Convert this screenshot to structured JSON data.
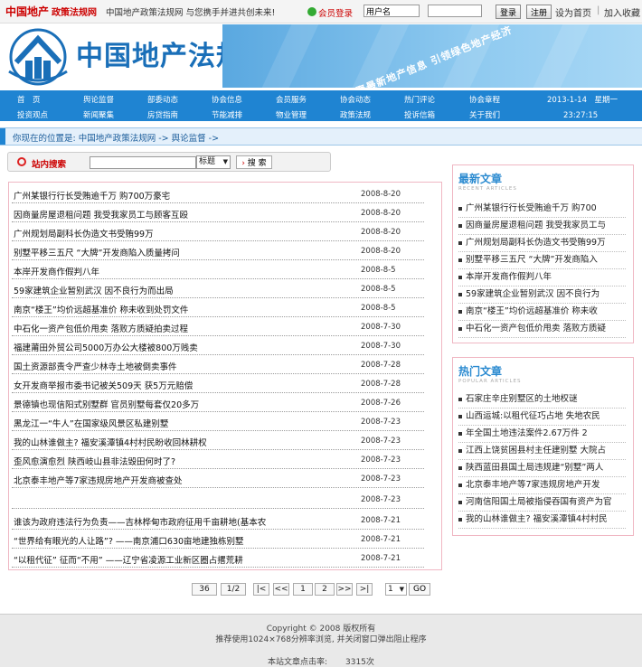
{
  "topbar": {
    "brand": "中国地产",
    "brand_sub": "政策法规网",
    "slogan": "中国地产政策法规网 与您携手并进共创未来!",
    "login_label": "会员登录",
    "username_value": "用户名",
    "login_button": "登录",
    "register_button": "注册",
    "set_home": "设为首页",
    "add_fav": "加入收藏"
  },
  "banner": {
    "logo_text": "中国地产法规网",
    "ad_text": "汇聚最新地产信息  引领绿色地产经济"
  },
  "nav": {
    "row1": [
      "首　页",
      "舆论监督",
      "部委动态",
      "协会信息",
      "会员服务",
      "协会动态",
      "热门评论",
      "协会章程"
    ],
    "row2": [
      "投资观点",
      "新闻聚集",
      "房贷指南",
      "节能减排",
      "物业管理",
      "政策法规",
      "投诉信箱",
      "关于我们"
    ],
    "date": "2013-1-14　星期一",
    "time": "23:27:15"
  },
  "breadcrumb": "你现在的位置是:  中国地产政策法规网 ->  舆论监督 ->",
  "search": {
    "label": "站内搜索",
    "select_value": "标题",
    "button": "搜 索"
  },
  "articles": [
    {
      "title": "广州某银行行长受贿逾千万 购700万豪宅",
      "date": "2008-8-20"
    },
    {
      "title": "因商量房屋退租问题 我受我家员工与顾客互殴",
      "date": "2008-8-20"
    },
    {
      "title": "广州规划局副科长伪造文书受贿99万",
      "date": "2008-8-20"
    },
    {
      "title": "别墅平移三五尺 “大牌”开发商陷入质量拷问",
      "date": "2008-8-20"
    },
    {
      "title": "本岸开发商作假判八年",
      "date": "2008-8-5"
    },
    {
      "title": "59家建筑企业暂别武汉 因不良行为而出局",
      "date": "2008-8-5"
    },
    {
      "title": "南京“楼王”均价远超基准价 称未收到处罚文件",
      "date": "2008-8-5"
    },
    {
      "title": "中石化一资产包低价甩卖 落败方质疑拍卖过程",
      "date": "2008-7-30"
    },
    {
      "title": "福建莆田外贸公司5000万办公大楼被800万贱卖",
      "date": "2008-7-30"
    },
    {
      "title": "国土资源部责令严查少林寺土地被倒卖事件",
      "date": "2008-7-28"
    },
    {
      "title": "女开发商举报市委书记被关509天 获5万元赔偿",
      "date": "2008-7-28"
    },
    {
      "title": "景德镇也现信阳式别墅群 官员别墅每套仅20多万",
      "date": "2008-7-26"
    },
    {
      "title": "黑龙江一“牛人”在国家级风景区私建别墅",
      "date": "2008-7-23"
    },
    {
      "title": "我的山林谁做主? 福安溪潭镇4村村民盼收回林耕权",
      "date": "2008-7-23"
    },
    {
      "title": "歪风愈演愈烈 陕西岐山县非法毁田何时了?",
      "date": "2008-7-23"
    },
    {
      "title": "北京泰丰地产等7家违规房地产开发商被查处",
      "date": "2008-7-23"
    },
    {
      "title": "",
      "date": "2008-7-23"
    },
    {
      "title": "谁该为政府违法行为负责——吉林桦甸市政府征用千亩耕地(基本农",
      "date": "2008-7-21"
    },
    {
      "title": "“世界给有眼光的人让路”? ——南京浦口630亩地建独栋别墅",
      "date": "2008-7-21"
    },
    {
      "title": "“以租代征” 征而“不用” ——辽宁省凌源工业新区圈占撂荒耕",
      "date": "2008-7-21"
    }
  ],
  "pager": {
    "total": "36",
    "page_of": "1/2",
    "first": "|<",
    "prev": "<<",
    "p1": "1",
    "p2": "2",
    "next": ">>",
    "last": ">|",
    "select_value": "1",
    "go": "GO"
  },
  "latest": {
    "title": "最新文章",
    "sub": "RECENT ARTICLES",
    "items": [
      "广州某银行行长受贿逾千万 购700",
      "因商量房屋退租问题 我受我家员工与",
      "广州规划局副科长伪造文书受贿99万",
      "别墅平移三五尺 “大牌”开发商陷入",
      "本岸开发商作假判八年",
      "59家建筑企业暂别武汉 因不良行为",
      "南京“楼王”均价远超基准价 称未收",
      "中石化一资产包低价甩卖 落败方质疑"
    ]
  },
  "popular": {
    "title": "热门文章",
    "sub": "POPULAR ARTICLES",
    "items": [
      "石家庄辛庄别墅区的土地权谜",
      "山西运城:以租代征巧占地 失地农民",
      "年全国土地违法案件2.67万件 2",
      "江西上饶贫困县村主任建别墅 大院占",
      "陕西蓝田县国土局违规建“别墅”两人",
      "北京泰丰地产等7家违规房地产开发",
      "河南信阳国土局被指侵吞国有资产为官",
      "我的山林谁做主? 福安溪潭镇4村村民"
    ]
  },
  "footer": {
    "copyright": "Copyright © 2008 版权所有",
    "note": "推荐使用1024×768分辨率浏览, 并关闭窗口弹出阻止程序",
    "hits_label": "本站文章点击率:",
    "hits": "3315次"
  }
}
